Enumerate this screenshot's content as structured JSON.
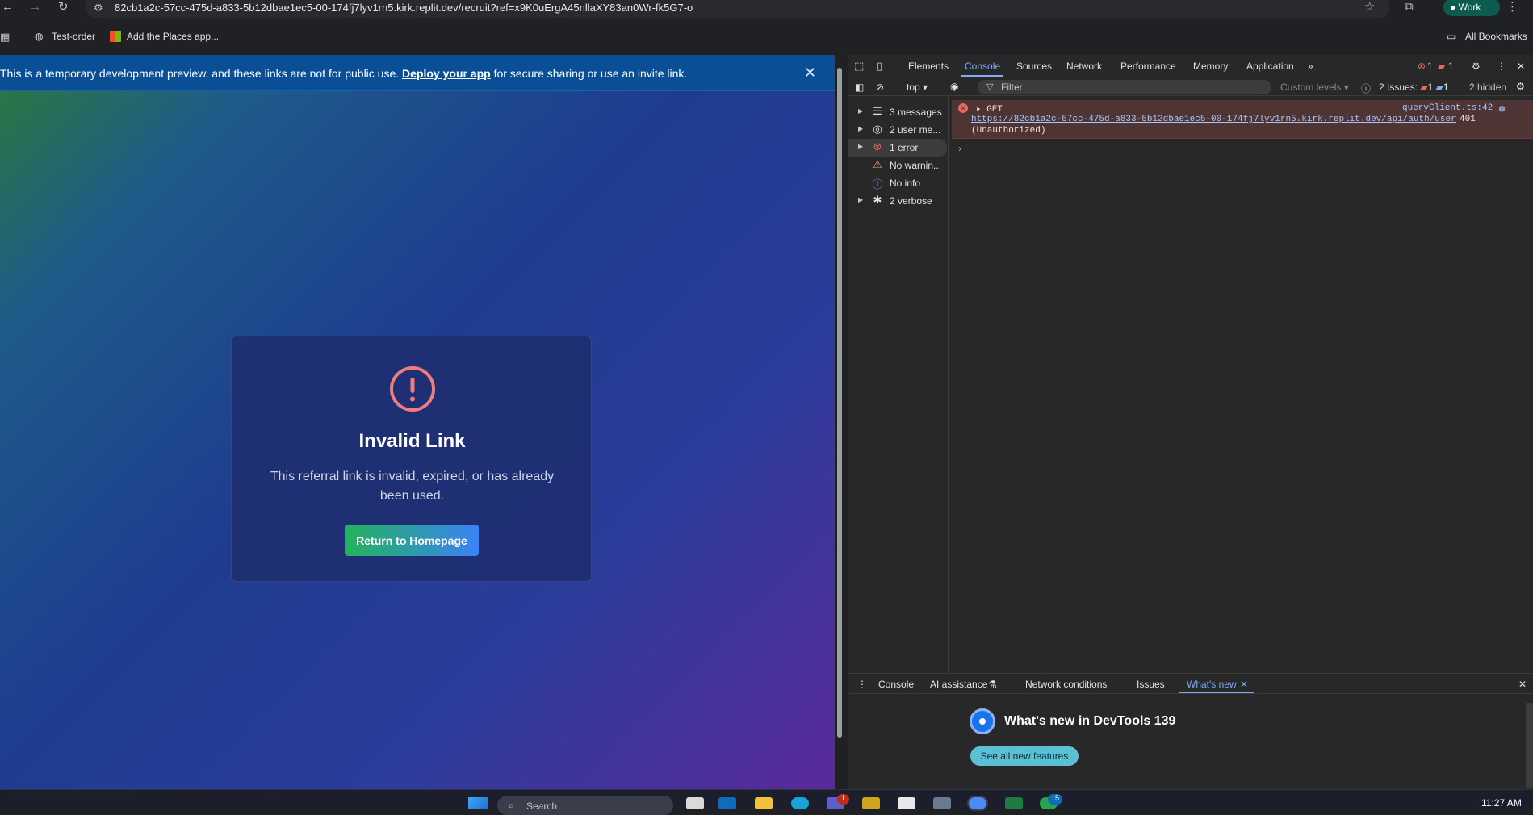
{
  "browser": {
    "url": "82cb1a2c-57cc-475d-a833-5b12dbae1ec5-00-174fj7lyv1rn5.kirk.replit.dev/recruit?ref=x9K0uErgA45nllaXY83an0Wr-fk5G7-o",
    "profile": "Work",
    "bookmarks": [
      "Test-order",
      "Add the Places app..."
    ],
    "all_bookmarks": "All Bookmarks"
  },
  "banner": {
    "text_before": "This is a temporary development preview, and these links are not for public use.",
    "link": "Deploy your app",
    "text_after": "for secure sharing or use an invite link."
  },
  "card": {
    "icon": "exclamation-circle-icon",
    "title": "Invalid Link",
    "message": "This referral link is invalid, expired, or has already been used.",
    "button": "Return to Homepage"
  },
  "devtools": {
    "tabs": [
      "Elements",
      "Console",
      "Sources",
      "Network",
      "Performance",
      "Memory",
      "Application"
    ],
    "active_tab": "Console",
    "error_count": "1",
    "message_count": "1",
    "context": "top",
    "filter_placeholder": "Filter",
    "levels": "Custom levels",
    "issues_label": "2 Issues:",
    "issues_err": "1",
    "issues_msg": "1",
    "hidden": "2 hidden",
    "sidebar": [
      {
        "label": "3 messages",
        "icon": "list-icon"
      },
      {
        "label": "2 user me...",
        "icon": "user-icon"
      },
      {
        "label": "1 error",
        "icon": "error-icon"
      },
      {
        "label": "No warnin...",
        "icon": "warning-icon"
      },
      {
        "label": "No info",
        "icon": "info-icon"
      },
      {
        "label": "2 verbose",
        "icon": "bug-icon"
      }
    ],
    "error": {
      "method": "GET",
      "source": "queryClient.ts:42",
      "url": "https://82cb1a2c-57cc-475d-a833-5b12dbae1ec5-00-174fj7lyv1rn5.kirk.replit.dev/api/auth/user",
      "code": "401",
      "status": "(Unauthorized)"
    },
    "drawer_tabs": [
      "Console",
      "AI assistance",
      "Network conditions",
      "Issues",
      "What's new"
    ],
    "active_drawer_tab": "What's new",
    "whats_new_title": "What's new in DevTools 139",
    "whats_new_button": "See all new features"
  },
  "taskbar": {
    "search": "Search",
    "time": "11:27 AM",
    "badge_teams": "1",
    "badge_other": "15"
  },
  "colors": {
    "banner": "#0a4f96",
    "error_bg": "#4e3534",
    "accent": "#7cacf8",
    "button_start": "#22b35a",
    "button_end": "#3b82f6"
  }
}
